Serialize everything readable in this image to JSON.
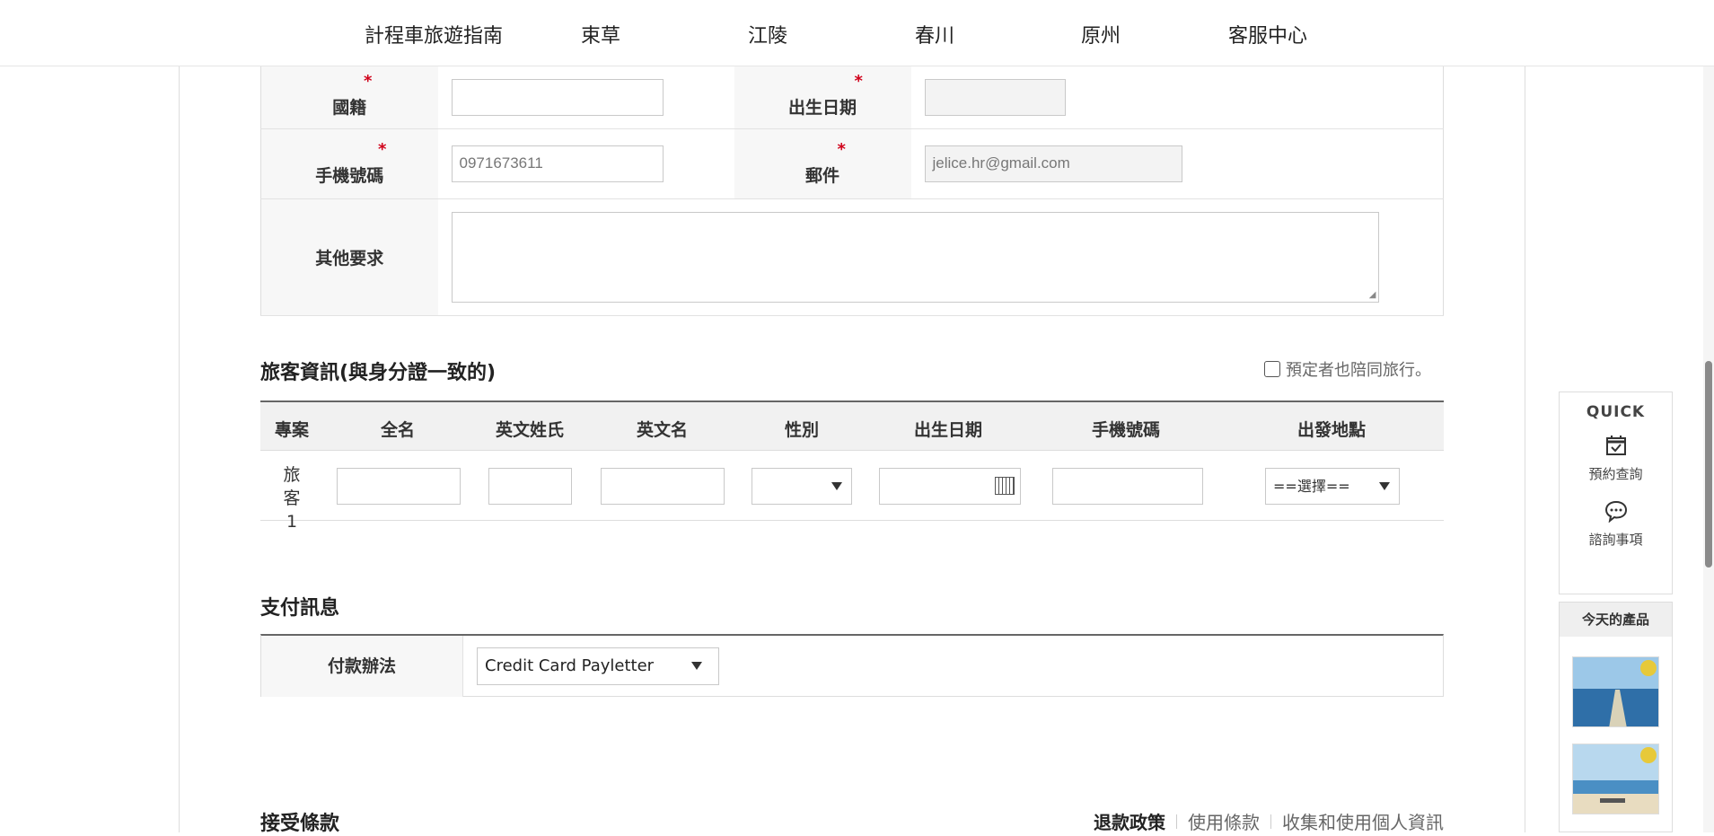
{
  "topnav": {
    "items": [
      "計程車旅遊指南",
      "束草",
      "江陵",
      "春川",
      "原州",
      "客服中心"
    ]
  },
  "booker": {
    "nationality_label": "國籍",
    "birthdate_label": "出生日期",
    "phone_label": "手機號碼",
    "phone_value": "0971673611",
    "email_label": "郵件",
    "email_value": "jelice.hr@gmail.com",
    "other_label": "其他要求",
    "required_mark": "*"
  },
  "passenger": {
    "title": "旅客資訊(與身分證一致的)",
    "companion_label": "預定者也陪同旅行。",
    "columns": [
      "專案",
      "全名",
      "英文姓氏",
      "英文名",
      "性別",
      "出生日期",
      "手機號碼",
      "出發地點"
    ],
    "row_label": "旅客1",
    "departure_placeholder": "==選擇=="
  },
  "payment": {
    "title": "支付訊息",
    "method_label": "付款辦法",
    "method_value": "Credit Card Payletter"
  },
  "terms": {
    "title": "接受條款",
    "links": [
      "退款政策",
      "使用條款",
      "收集和使用個人資訊"
    ]
  },
  "quick": {
    "title": "QUICK",
    "items": [
      "預約查詢",
      "諮詢事項"
    ]
  },
  "today": {
    "title": "今天的產品"
  }
}
